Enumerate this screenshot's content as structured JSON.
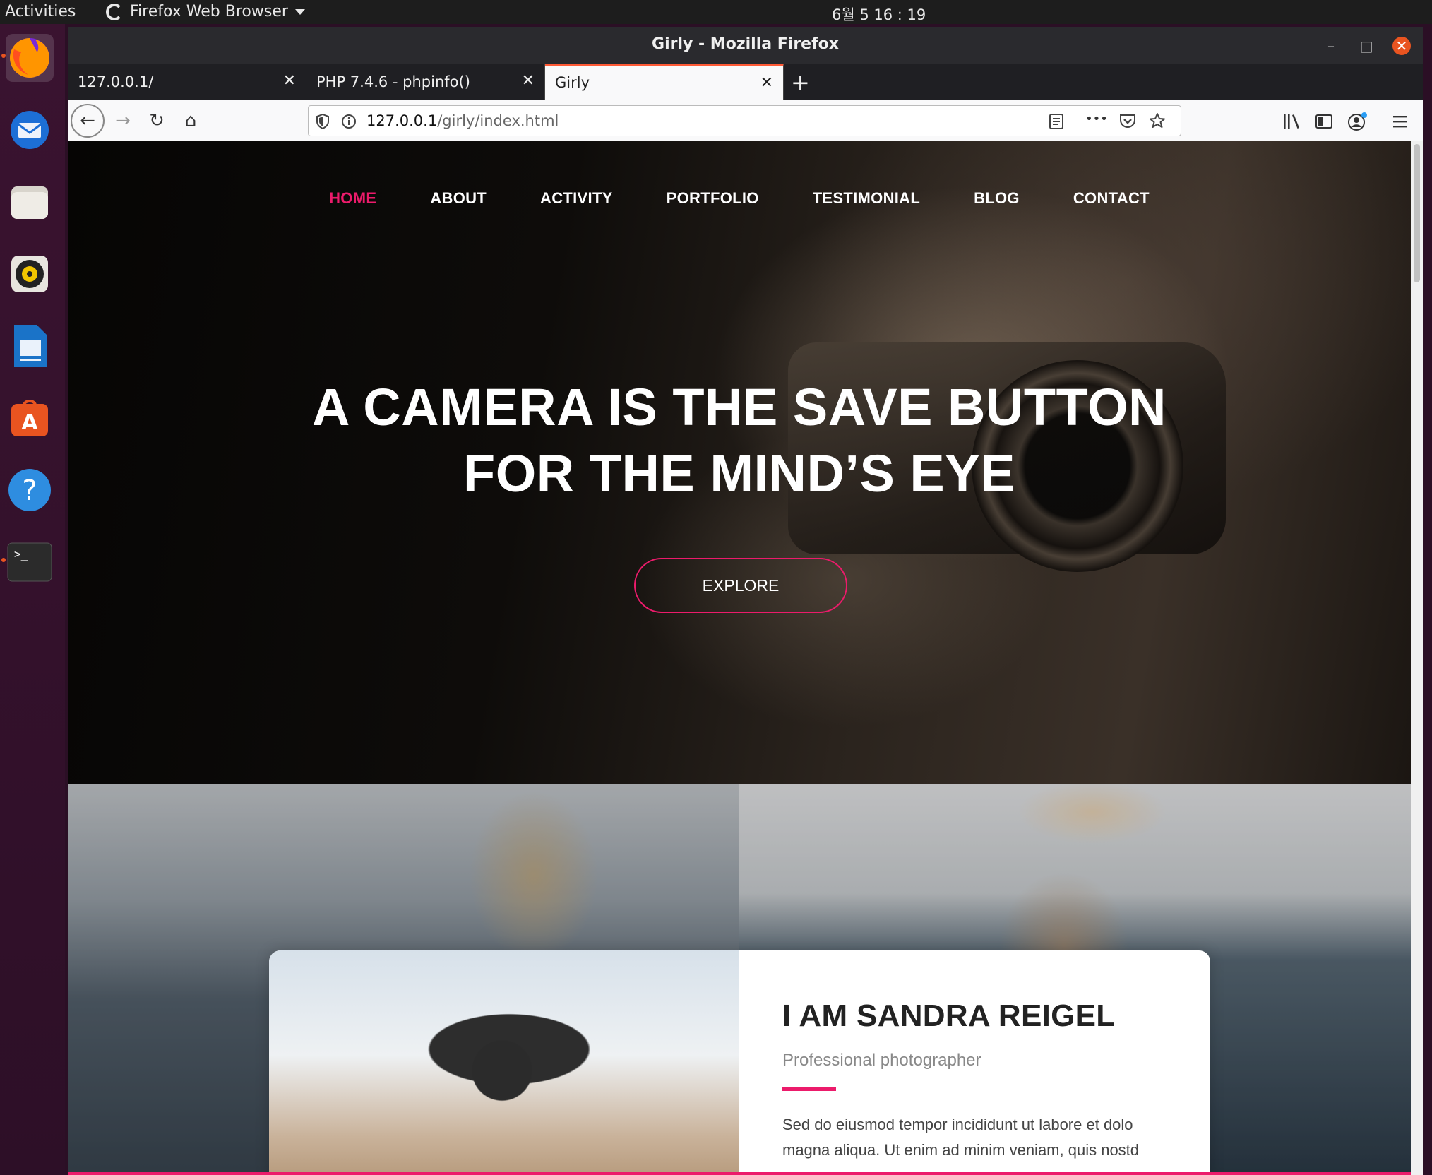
{
  "system": {
    "activities": "Activities",
    "app_menu": "Firefox Web Browser",
    "clock": "6월 5  16 : 19"
  },
  "dock": {
    "items": [
      {
        "name": "firefox",
        "icon": "firefox-icon"
      },
      {
        "name": "thunderbird",
        "icon": "mail-icon"
      },
      {
        "name": "files",
        "icon": "folder-icon"
      },
      {
        "name": "rhythmbox",
        "icon": "speaker-icon"
      },
      {
        "name": "writer",
        "icon": "document-icon"
      },
      {
        "name": "software",
        "icon": "store-icon"
      },
      {
        "name": "help",
        "icon": "help-icon"
      },
      {
        "name": "terminal",
        "icon": "terminal-icon"
      }
    ],
    "help_glyph": "?",
    "terminal_glyph": ">_",
    "store_glyph": "A"
  },
  "window": {
    "title": "Girly - Mozilla Firefox",
    "minimize": "–",
    "maximize": "□",
    "close": "✕"
  },
  "tabs": [
    {
      "label": "127.0.0.1/",
      "close": "✕"
    },
    {
      "label": "PHP 7.4.6 - phpinfo()",
      "close": "✕"
    },
    {
      "label": "Girly",
      "close": "✕"
    }
  ],
  "new_tab": "+",
  "navbar": {
    "back": "←",
    "forward": "→",
    "reload": "↻",
    "home": "⌂",
    "url_host": "127.0.0.1",
    "url_path": "/girly/index.html",
    "more": "•••"
  },
  "site": {
    "nav": [
      "HOME",
      "ABOUT",
      "ACTIVITY",
      "PORTFOLIO",
      "TESTIMONIAL",
      "BLOG",
      "CONTACT"
    ],
    "hero_line1": "A CAMERA IS THE SAVE BUTTON",
    "hero_line2": "FOR THE MIND’S EYE",
    "explore": "EXPLORE",
    "about_title": "I AM SANDRA REIGEL",
    "about_subtitle": "Professional photographer",
    "about_body": "Sed do eiusmod tempor incididunt ut labore et dolo magna aliqua. Ut enim ad minim veniam, quis nostd"
  },
  "colors": {
    "accent": "#ec1b6b",
    "tab_highlight": "#ff5a36",
    "ubuntu_orange": "#e95420"
  }
}
